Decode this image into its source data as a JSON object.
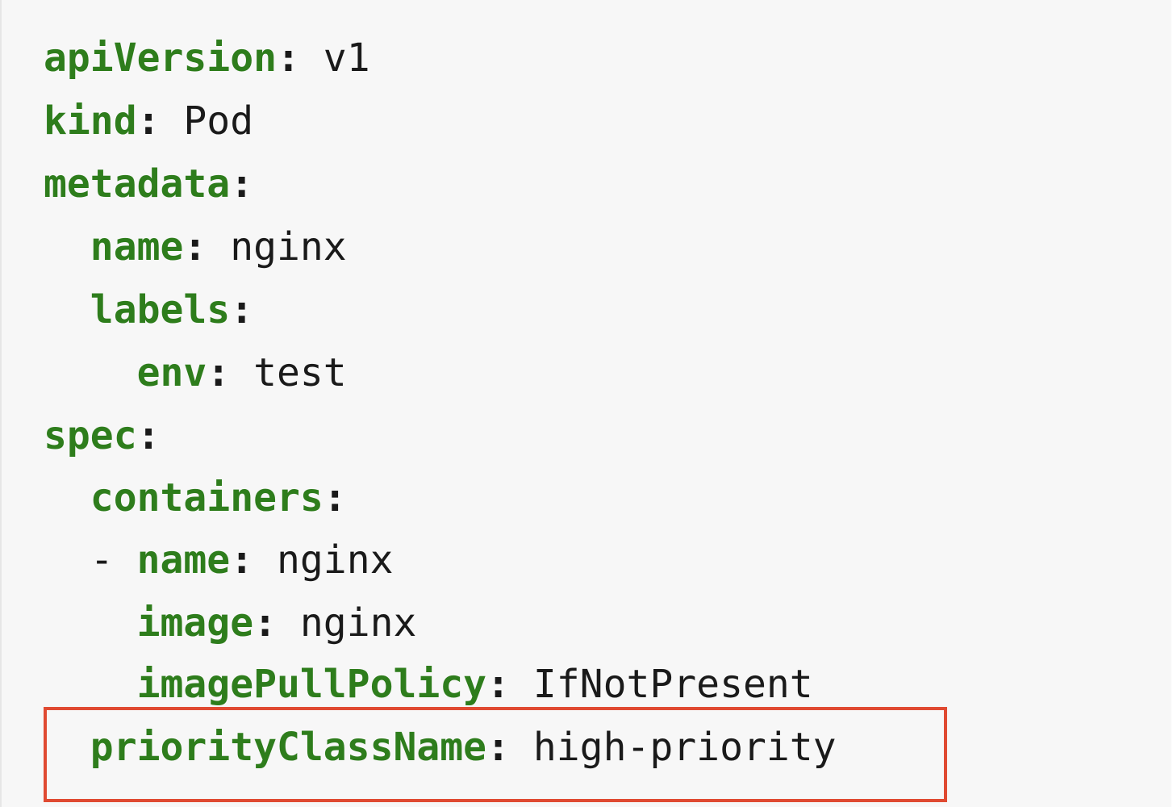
{
  "lines": [
    {
      "indent": "",
      "key": "apiVersion",
      "value": " v1"
    },
    {
      "indent": "",
      "key": "kind",
      "value": " Pod"
    },
    {
      "indent": "",
      "key": "metadata",
      "value": ""
    },
    {
      "indent": "  ",
      "key": "name",
      "value": " nginx"
    },
    {
      "indent": "  ",
      "key": "labels",
      "value": ""
    },
    {
      "indent": "    ",
      "key": "env",
      "value": " test"
    },
    {
      "indent": "",
      "key": "spec",
      "value": ""
    },
    {
      "indent": "  ",
      "key": "containers",
      "value": ""
    },
    {
      "indent": "  - ",
      "key": "name",
      "value": " nginx"
    },
    {
      "indent": "    ",
      "key": "image",
      "value": " nginx"
    },
    {
      "indent": "    ",
      "key": "imagePullPolicy",
      "value": " IfNotPresent"
    },
    {
      "indent": "  ",
      "key": "priorityClassName",
      "value": " high-priority"
    }
  ],
  "colors": {
    "key": "#2e7d1c",
    "text": "#1a1a1a",
    "background": "#f7f7f7",
    "highlight_border": "#e04a32"
  }
}
